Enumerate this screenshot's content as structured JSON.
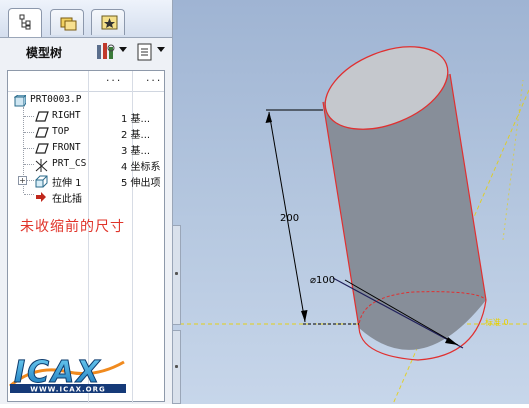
{
  "panel": {
    "tabs": [
      {
        "icon": "model-tree-icon",
        "active": true
      },
      {
        "icon": "folder-browser-icon",
        "active": false
      },
      {
        "icon": "favorites-icon",
        "active": false
      }
    ],
    "title": "模型树",
    "settings_icon": "tree-settings-icon",
    "show_icon": "tree-show-icon"
  },
  "tree": {
    "columns": [
      "...",
      "..."
    ],
    "rows": [
      {
        "label": "PRT0003.P",
        "c2": "",
        "icon": "part-icon"
      },
      {
        "label": "RIGHT",
        "c2": "1  基...",
        "icon": "datum-plane-icon"
      },
      {
        "label": "TOP",
        "c2": "2  基...",
        "icon": "datum-plane-icon"
      },
      {
        "label": "FRONT",
        "c2": "3  基...",
        "icon": "datum-plane-icon"
      },
      {
        "label": "PRT_CS",
        "c2": "4 坐标系",
        "icon": "csys-icon"
      },
      {
        "label": "拉伸 1",
        "c2": "5 伸出项",
        "icon": "extrude-icon"
      },
      {
        "label": "在此插",
        "c2": "",
        "icon": "insert-here-icon"
      }
    ]
  },
  "annotation": "未收缩前的尺寸",
  "logo": {
    "brand": "ICAX",
    "url": "WWW.ICAX.ORG"
  },
  "viewport": {
    "dim_length": "200",
    "dim_diameter": "⌀100",
    "axis_label": "标准 0",
    "colors": {
      "cylinder_edge": "#e03030",
      "datum": "#e8d000",
      "dimension": "#000000",
      "axis": "#20205a"
    }
  }
}
